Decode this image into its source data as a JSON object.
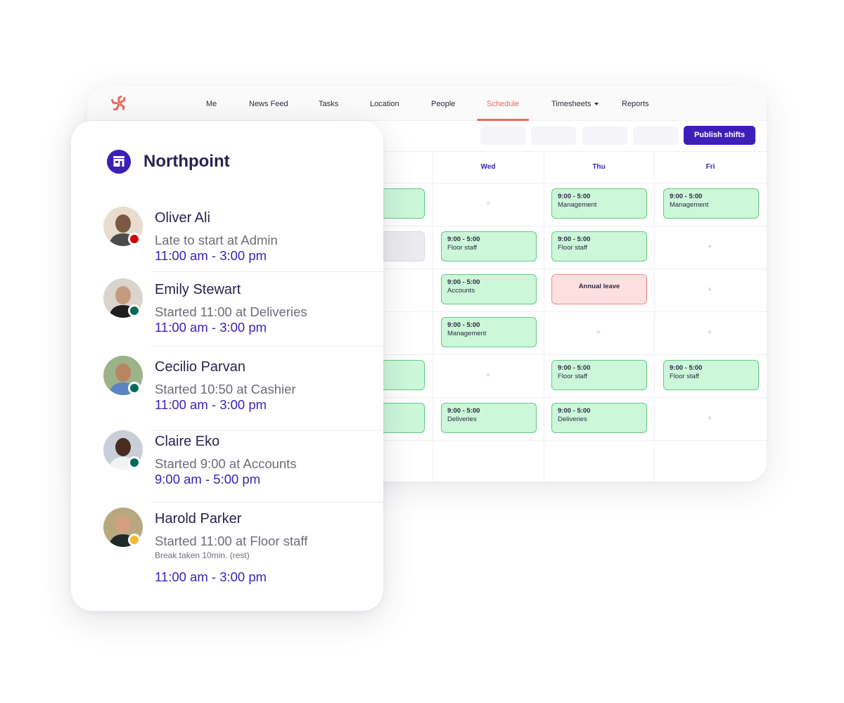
{
  "colors": {
    "brand": "#3d1fb8",
    "accent": "#f0675c",
    "shift_bg": "#ccf7d9",
    "shift_border": "#5fcb84",
    "leave_bg": "#ffe0e0",
    "status_late": "#d10000",
    "status_started": "#006b5c",
    "status_break": "#f5b82e"
  },
  "nav": {
    "logo_icon": "starburst-logo-icon",
    "items": [
      {
        "label": "Me"
      },
      {
        "label": "News Feed"
      },
      {
        "label": "Tasks"
      },
      {
        "label": "Location"
      },
      {
        "label": "People"
      },
      {
        "label": "Schedule",
        "active": true
      },
      {
        "label": "Timesheets",
        "dropdown": true
      },
      {
        "label": "Reports"
      }
    ]
  },
  "toolbar": {
    "publish_label": "Publish shifts"
  },
  "schedule": {
    "days": [
      "Wed",
      "Thu",
      "Fri"
    ],
    "rows": [
      {
        "prev": "shift",
        "wed": null,
        "thu": {
          "time": "9:00 - 5:00",
          "role": "Management"
        },
        "fri": {
          "time": "9:00 - 5:00",
          "role": "Management"
        }
      },
      {
        "prev": "grey",
        "wed": {
          "time": "9:00 - 5:00",
          "role": "Floor staff"
        },
        "thu": {
          "time": "9:00 - 5:00",
          "role": "Floor staff"
        },
        "fri": null
      },
      {
        "prev": null,
        "wed": {
          "time": "9:00 - 5:00",
          "role": "Accounts"
        },
        "thu": {
          "leave": "Annual leave"
        },
        "fri": null
      },
      {
        "prev": null,
        "wed": {
          "time": "9:00 - 5:00",
          "role": "Management"
        },
        "thu": null,
        "fri": null
      },
      {
        "prev": "shift",
        "wed": null,
        "thu": {
          "time": "9:00 - 5:00",
          "role": "Floor staff"
        },
        "fri": {
          "time": "9:00 - 5:00",
          "role": "Floor staff"
        }
      },
      {
        "prev": "shift",
        "wed": {
          "time": "9:00 - 5:00",
          "role": "Deliveries"
        },
        "thu": {
          "time": "9:00 - 5:00",
          "role": "Deliveries"
        },
        "fri": null
      }
    ],
    "add_symbol": "+"
  },
  "panel": {
    "location_icon": "store-icon",
    "location": "Northpoint",
    "people": [
      {
        "name": "Oliver Ali",
        "status": "Late to start at Admin",
        "time": "11:00 am - 3:00 pm",
        "state": "late"
      },
      {
        "name": "Emily Stewart",
        "status": "Started 11:00 at Deliveries",
        "time": "11:00 am - 3:00 pm",
        "state": "started"
      },
      {
        "name": "Cecilio Parvan",
        "status": "Started 10:50 at Cashier",
        "time": "11:00 am - 3:00 pm",
        "state": "started"
      },
      {
        "name": "Claire Eko",
        "status": "Started 9:00 at Accounts",
        "time": "9:00 am - 5:00 pm",
        "state": "started"
      },
      {
        "name": "Harold Parker",
        "status": "Started 11:00 at Floor staff",
        "note": "Break taken 10min. (rest)",
        "time": "11:00 am - 3:00 pm",
        "state": "break"
      }
    ]
  }
}
